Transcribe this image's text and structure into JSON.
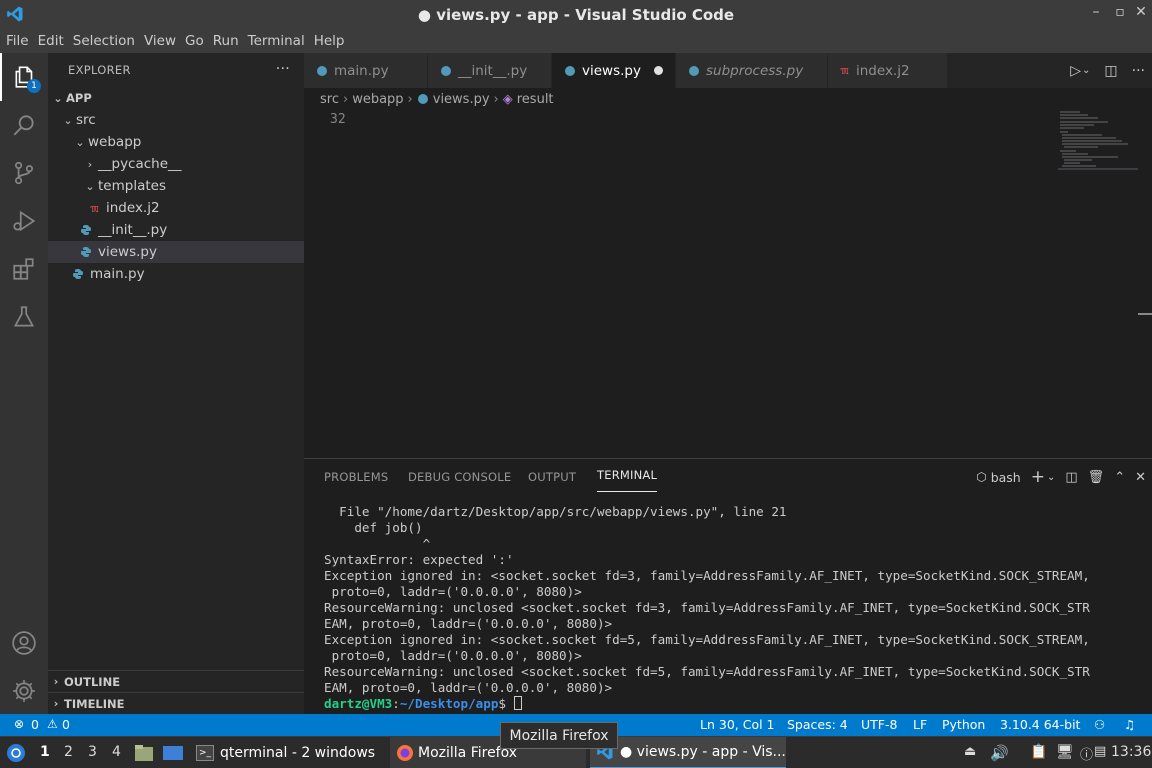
{
  "window": {
    "title": "● views.py - app - Visual Studio Code"
  },
  "menu": [
    "File",
    "Edit",
    "Selection",
    "View",
    "Go",
    "Run",
    "Terminal",
    "Help"
  ],
  "activity": {
    "explorer_badge": "1"
  },
  "explorer": {
    "header": "EXPLORER",
    "more": "···",
    "root": "APP",
    "items": [
      {
        "label": "src"
      },
      {
        "label": "webapp"
      },
      {
        "label": "__pycache__"
      },
      {
        "label": "templates"
      },
      {
        "label": "index.j2"
      },
      {
        "label": "__init__.py"
      },
      {
        "label": "views.py"
      },
      {
        "label": "main.py"
      }
    ],
    "outline": "OUTLINE",
    "timeline": "TIMELINE"
  },
  "tabs": [
    {
      "label": "main.py"
    },
    {
      "label": "__init__.py"
    },
    {
      "label": "views.py"
    },
    {
      "label": "subprocess.py"
    },
    {
      "label": "index.j2"
    }
  ],
  "breadcrumb": [
    "src",
    "webapp",
    "views.py",
    "result"
  ],
  "editor": {
    "line_number": "32"
  },
  "panel": {
    "tabs": [
      "PROBLEMS",
      "DEBUG CONSOLE",
      "OUTPUT",
      "TERMINAL"
    ],
    "shell": "bash"
  },
  "terminal": {
    "lines": [
      "  File \"/home/dartz/Desktop/app/src/webapp/views.py\", line 21",
      "    def job()",
      "             ^",
      "SyntaxError: expected ':'",
      "Exception ignored in: <socket.socket fd=3, family=AddressFamily.AF_INET, type=SocketKind.SOCK_STREAM,",
      " proto=0, laddr=('0.0.0.0', 8080)>",
      "ResourceWarning: unclosed <socket.socket fd=3, family=AddressFamily.AF_INET, type=SocketKind.SOCK_STR",
      "EAM, proto=0, laddr=('0.0.0.0', 8080)>",
      "Exception ignored in: <socket.socket fd=5, family=AddressFamily.AF_INET, type=SocketKind.SOCK_STREAM,",
      " proto=0, laddr=('0.0.0.0', 8080)>",
      "ResourceWarning: unclosed <socket.socket fd=5, family=AddressFamily.AF_INET, type=SocketKind.SOCK_STR",
      "EAM, proto=0, laddr=('0.0.0.0', 8080)>"
    ],
    "prompt_user": "dartz@VM3",
    "prompt_path": "~/Desktop/app",
    "prompt_suffix": "$ "
  },
  "status": {
    "errors": "0",
    "warnings": "0",
    "position": "Ln 30, Col 1",
    "spaces": "Spaces: 4",
    "encoding": "UTF-8",
    "eol": "LF",
    "language": "Python",
    "interpreter": "3.10.4 64-bit"
  },
  "taskbar": {
    "workspaces": [
      "1",
      "2",
      "3",
      "4"
    ],
    "qterminal": "qterminal - 2 windows",
    "firefox": "Mozilla Firefox",
    "vscode": "● views.py - app - Vis...",
    "clock": "13:36"
  },
  "tooltip": "Mozilla Firefox",
  "colors": {
    "accent": "#007acc",
    "python_icon": "#519aba",
    "jinja_icon": "#e44d4d"
  }
}
